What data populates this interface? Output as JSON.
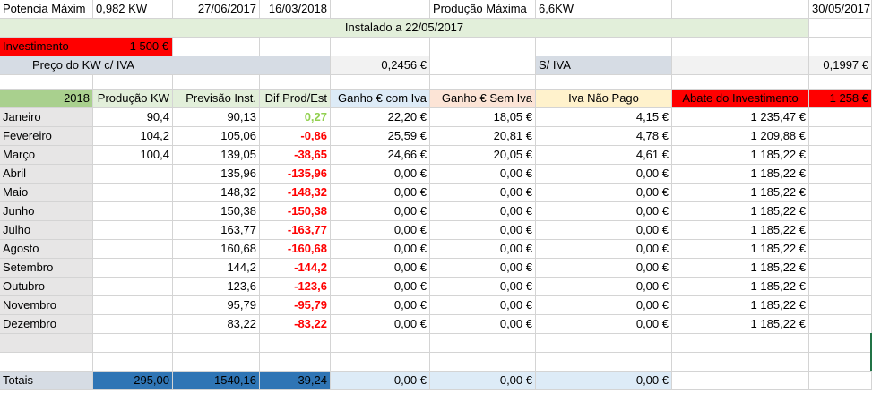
{
  "header": {
    "pot_label": "Potencia Máxim",
    "pot_value": "0,982 KW",
    "date1": "27/06/2017",
    "date2": "16/03/2018",
    "prod_max_label": "Produção Máxima",
    "prod_max_value": "6,6KW",
    "date3": "30/05/2017",
    "installed": "Instalado a 22/05/2017",
    "invest_label": "Investimento",
    "invest_value": "1 500 €",
    "price_civa_label": "Preço do KW  c/ IVA",
    "price_civa_value": "0,2456 €",
    "siva_label": "S/ IVA",
    "siva_value": "0,1997 €"
  },
  "table": {
    "year": "2018",
    "col_prod": "Produção KW",
    "col_prev": "Previsão Inst.",
    "col_dif": "Dif Prod/Est",
    "col_gciva": "Ganho € com Iva",
    "col_gsiva": "Ganho € Sem Iva",
    "col_iva": "Iva Não Pago",
    "col_abate": "Abate do Investimento",
    "abate_value": "1 258 €",
    "rows": [
      {
        "month": "Janeiro",
        "prod": "90,4",
        "prev": "90,13",
        "dif": "0,27",
        "gciva": "22,20 €",
        "gsiva": "18,05 €",
        "iva": "4,15 €",
        "abate": "1 235,47 €"
      },
      {
        "month": "Fevereiro",
        "prod": "104,2",
        "prev": "105,06",
        "dif": "-0,86",
        "gciva": "25,59 €",
        "gsiva": "20,81 €",
        "iva": "4,78 €",
        "abate": "1 209,88 €"
      },
      {
        "month": "Março",
        "prod": "100,4",
        "prev": "139,05",
        "dif": "-38,65",
        "gciva": "24,66 €",
        "gsiva": "20,05 €",
        "iva": "4,61 €",
        "abate": "1 185,22 €"
      },
      {
        "month": "Abril",
        "prod": "",
        "prev": "135,96",
        "dif": "-135,96",
        "gciva": "0,00 €",
        "gsiva": "0,00 €",
        "iva": "0,00 €",
        "abate": "1 185,22 €"
      },
      {
        "month": "Maio",
        "prod": "",
        "prev": "148,32",
        "dif": "-148,32",
        "gciva": "0,00 €",
        "gsiva": "0,00 €",
        "iva": "0,00 €",
        "abate": "1 185,22 €"
      },
      {
        "month": "Junho",
        "prod": "",
        "prev": "150,38",
        "dif": "-150,38",
        "gciva": "0,00 €",
        "gsiva": "0,00 €",
        "iva": "0,00 €",
        "abate": "1 185,22 €"
      },
      {
        "month": "Julho",
        "prod": "",
        "prev": "163,77",
        "dif": "-163,77",
        "gciva": "0,00 €",
        "gsiva": "0,00 €",
        "iva": "0,00 €",
        "abate": "1 185,22 €"
      },
      {
        "month": "Agosto",
        "prod": "",
        "prev": "160,68",
        "dif": "-160,68",
        "gciva": "0,00 €",
        "gsiva": "0,00 €",
        "iva": "0,00 €",
        "abate": "1 185,22 €"
      },
      {
        "month": "Setembro",
        "prod": "",
        "prev": "144,2",
        "dif": "-144,2",
        "gciva": "0,00 €",
        "gsiva": "0,00 €",
        "iva": "0,00 €",
        "abate": "1 185,22 €"
      },
      {
        "month": "Outubro",
        "prod": "",
        "prev": "123,6",
        "dif": "-123,6",
        "gciva": "0,00 €",
        "gsiva": "0,00 €",
        "iva": "0,00 €",
        "abate": "1 185,22 €"
      },
      {
        "month": "Novembro",
        "prod": "",
        "prev": "95,79",
        "dif": "-95,79",
        "gciva": "0,00 €",
        "gsiva": "0,00 €",
        "iva": "0,00 €",
        "abate": "1 185,22 €"
      },
      {
        "month": "Dezembro",
        "prod": "",
        "prev": "83,22",
        "dif": "-83,22",
        "gciva": "0,00 €",
        "gsiva": "0,00 €",
        "iva": "0,00 €",
        "abate": "1 185,22 €"
      }
    ],
    "totals_label": "Totais",
    "totals": {
      "prod": "295,00",
      "prev": "1540,16",
      "dif": "-39,24",
      "gciva": "0,00 €",
      "gsiva": "0,00 €",
      "iva": "0,00 €"
    }
  },
  "colors": {
    "green_light": "#e2efda",
    "green_header": "#a9d08e",
    "red": "#ff0000",
    "gray_blue": "#d6dce4",
    "blue_light": "#ddebf7",
    "peach": "#fce4d6",
    "yellow_light": "#fff2cc",
    "blue_dark": "#2f75b5",
    "month_gray": "#e7e6e6",
    "row_gray": "#f2f2f2"
  }
}
